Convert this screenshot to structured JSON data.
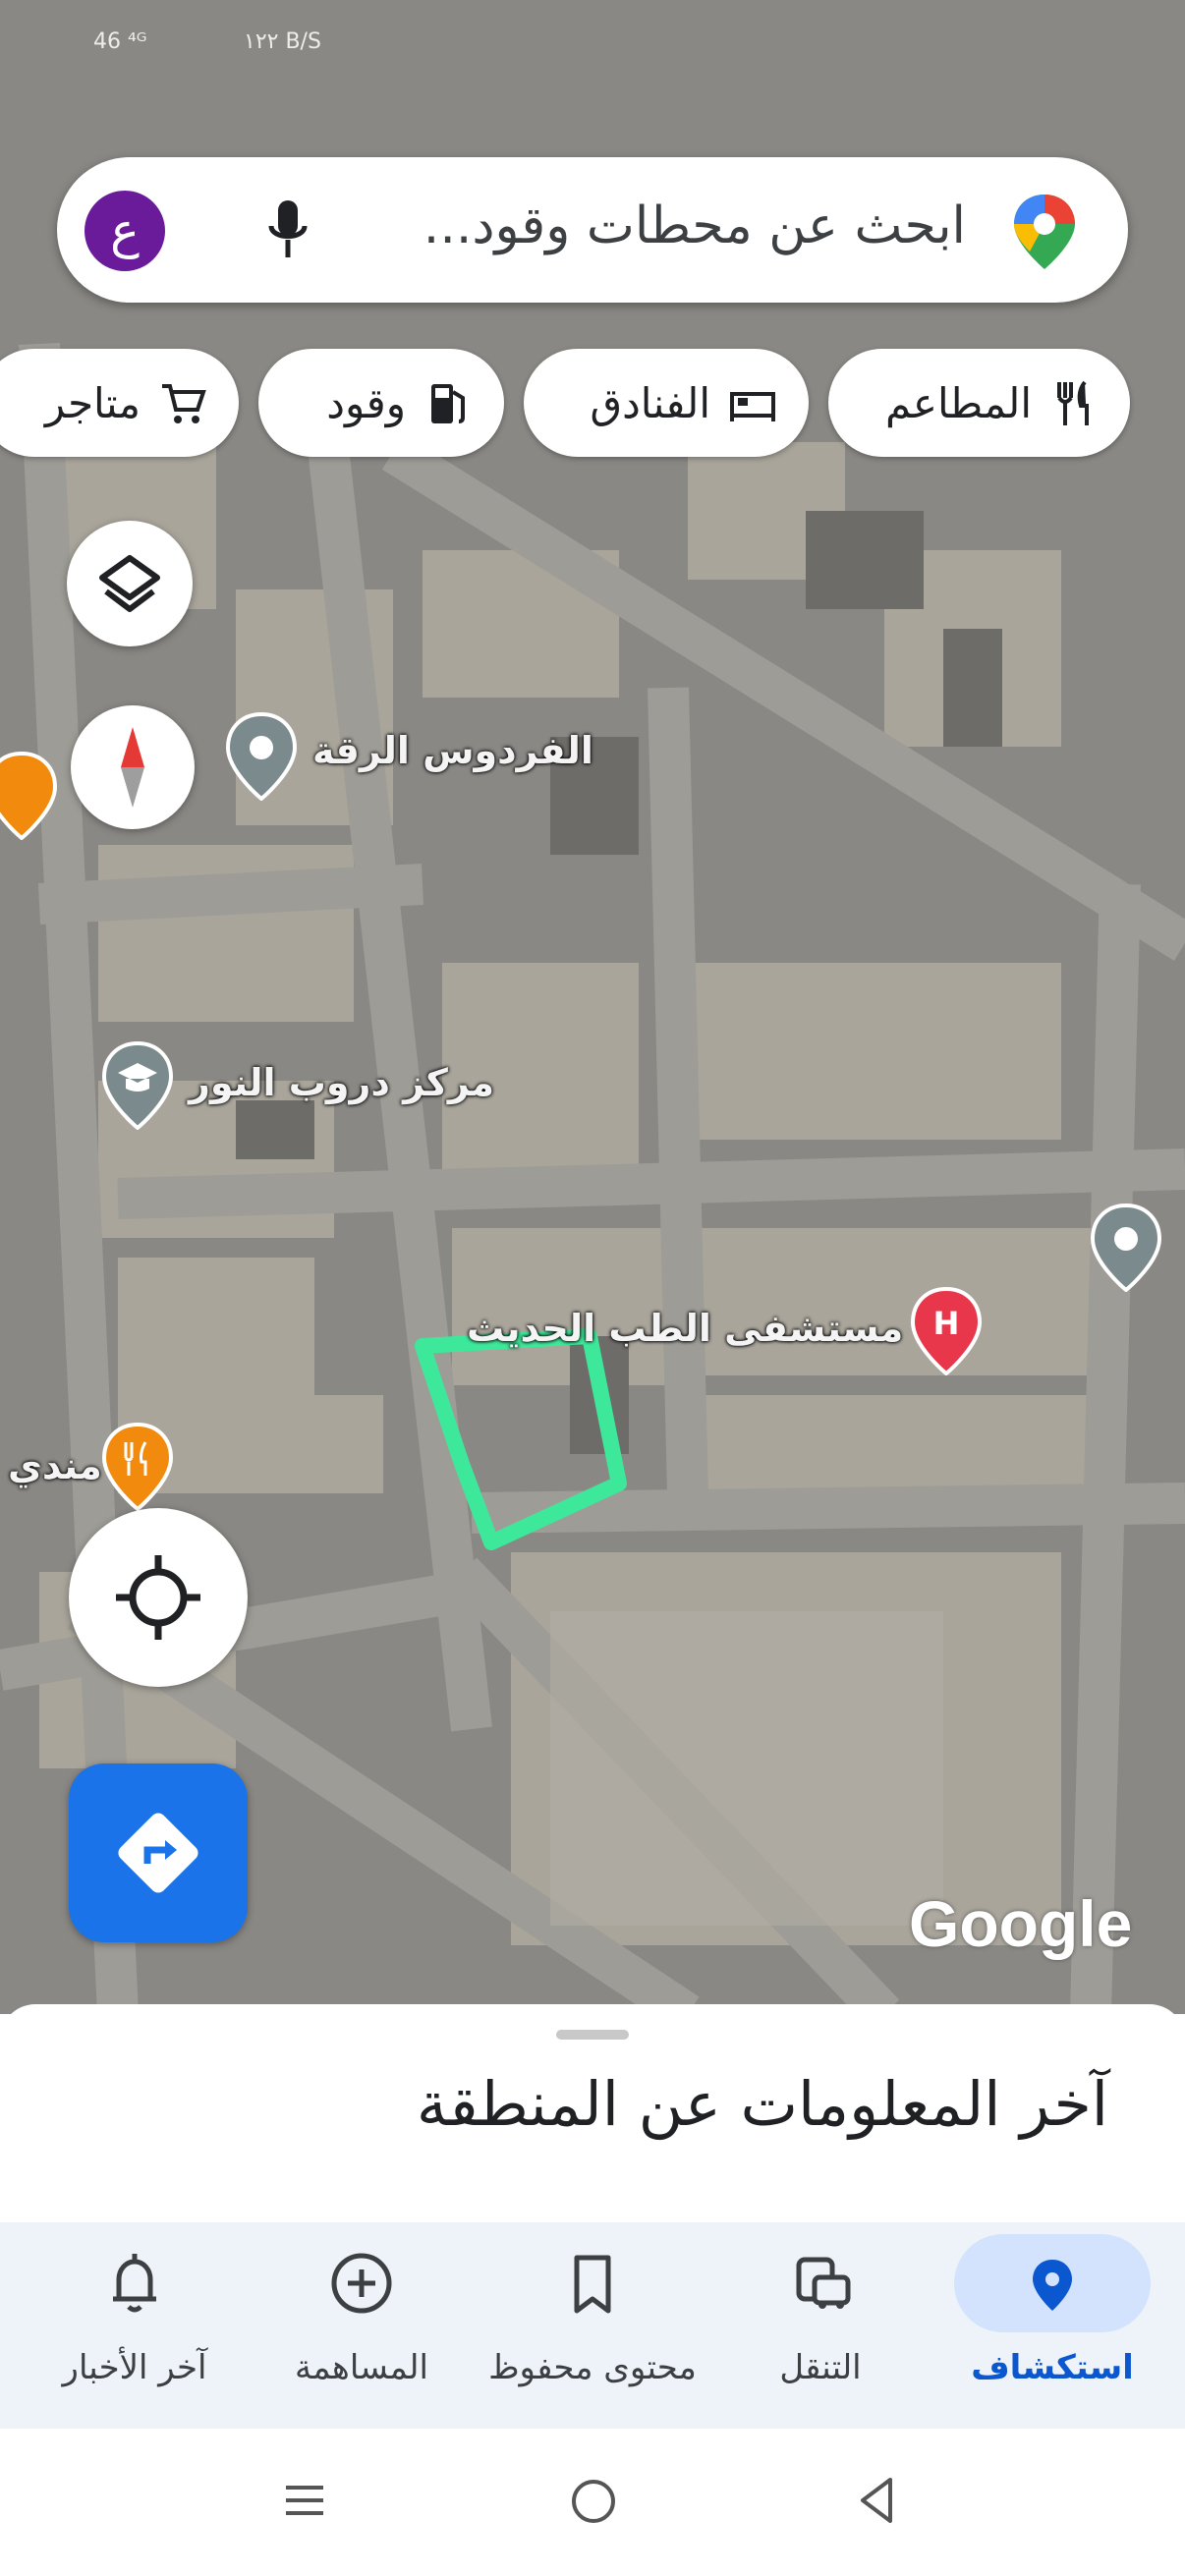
{
  "status_bar": {
    "left_text": "46 ⁴ᴳ",
    "center_text": "١٢٢ B/S"
  },
  "search": {
    "placeholder": "ابحث عن محطات وقود...",
    "avatar_letter": "ع"
  },
  "chips": [
    {
      "label": "المطاعم",
      "icon": "restaurant-icon"
    },
    {
      "label": "الفنادق",
      "icon": "hotel-icon"
    },
    {
      "label": "وقود",
      "icon": "gas-station-icon"
    },
    {
      "label": "متاجر",
      "icon": "cart-icon"
    }
  ],
  "map": {
    "places": [
      {
        "label": "الفردوس الرقة",
        "icon": "place-pin-icon"
      },
      {
        "label": "مركز دروب النور",
        "icon": "school-pin-icon"
      },
      {
        "label": "مستشفى الطب الحديث",
        "icon": "hospital-pin-icon"
      },
      {
        "label": "مندي",
        "icon": "restaurant-pin-icon"
      }
    ],
    "attribution": "Google",
    "colors": {
      "highlight": "#3ee89a",
      "hospital": "#e8374a",
      "restaurant": "#f28b0d",
      "place": "#7b8a8c"
    }
  },
  "sheet": {
    "title": "آخر المعلومات عن المنطقة"
  },
  "bottom_nav": [
    {
      "label": "استكشاف",
      "icon": "explore-pin-icon",
      "active": true
    },
    {
      "label": "التنقل",
      "icon": "commute-icon",
      "active": false
    },
    {
      "label": "محتوى محفوظ",
      "icon": "bookmark-icon",
      "active": false
    },
    {
      "label": "المساهمة",
      "icon": "add-circle-icon",
      "active": false
    },
    {
      "label": "آخر الأخبار",
      "icon": "bell-icon",
      "active": false
    }
  ],
  "accent_color": "#0b57d0"
}
